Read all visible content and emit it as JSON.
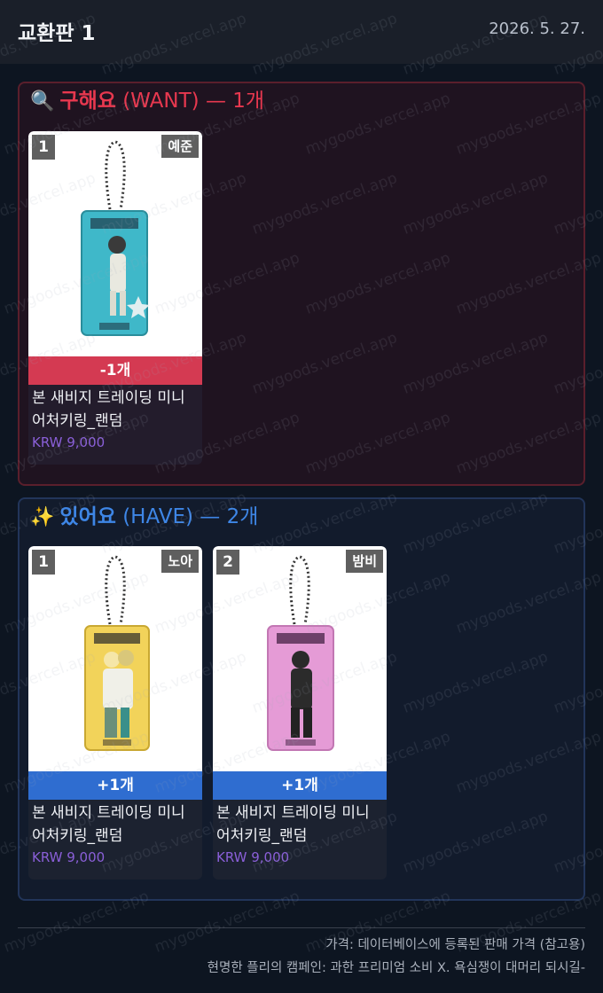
{
  "header": {
    "title": "교환판 1",
    "date": "2026. 5. 27."
  },
  "watermark": "mygoods.vercel.app",
  "want": {
    "icon": "🔍",
    "label": "구해요",
    "tag": "(WANT)",
    "sep": "—",
    "count": "1개",
    "accent": "#e8384f",
    "cards": [
      {
        "index": "1",
        "owner": "예준",
        "qty": "-1개",
        "name_line1": "본 새비지 트레이딩 미니",
        "name_line2": "어처키링_랜덤",
        "price": "KRW 9,000",
        "art_color": "#3fb8c9"
      }
    ]
  },
  "have": {
    "icon": "✨",
    "label": "있어요",
    "tag": "(HAVE)",
    "sep": "—",
    "count": "2개",
    "accent": "#3e86e6",
    "cards": [
      {
        "index": "1",
        "owner": "노아",
        "qty": "+1개",
        "name_line1": "본 새비지 트레이딩 미니",
        "name_line2": "어처키링_랜덤",
        "price": "KRW 9,000",
        "art_color": "#f2d35a"
      },
      {
        "index": "2",
        "owner": "밤비",
        "qty": "+1개",
        "name_line1": "본 새비지 트레이딩 미니",
        "name_line2": "어처키링_랜덤",
        "price": "KRW 9,000",
        "art_color": "#e59bd6"
      }
    ]
  },
  "footer": {
    "price_note": "가격: 데이터베이스에 등록된 판매 가격 (참고용)",
    "campaign_note": "현명한 플리의 캠페인: 과한 프리미엄 소비 X. 욕심쟁이 대머리 되시길-"
  }
}
